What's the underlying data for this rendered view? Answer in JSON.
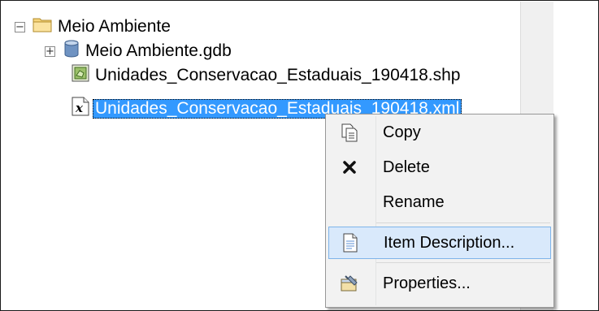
{
  "tree": {
    "root": {
      "label": "Meio Ambiente",
      "expander": "−"
    },
    "items": [
      {
        "label": "Meio Ambiente.gdb",
        "expander": "+"
      },
      {
        "label": "Unidades_Conservacao_Estaduais_190418.shp"
      },
      {
        "label": "Unidades_Conservacao_Estaduais_190418.xml"
      }
    ]
  },
  "context_menu": {
    "items": [
      {
        "label": "Copy",
        "icon": "copy-icon"
      },
      {
        "label": "Delete",
        "icon": "delete-icon"
      },
      {
        "label": "Rename",
        "icon": ""
      },
      {
        "label": "Item Description...",
        "icon": "item-description-icon"
      },
      {
        "label": "Properties...",
        "icon": "properties-icon"
      }
    ]
  },
  "colors": {
    "selection": "#3399ff",
    "menu_hover": "#d9e9fb",
    "menu_hover_border": "#7eb4ea",
    "folder": "#f0c75a"
  }
}
